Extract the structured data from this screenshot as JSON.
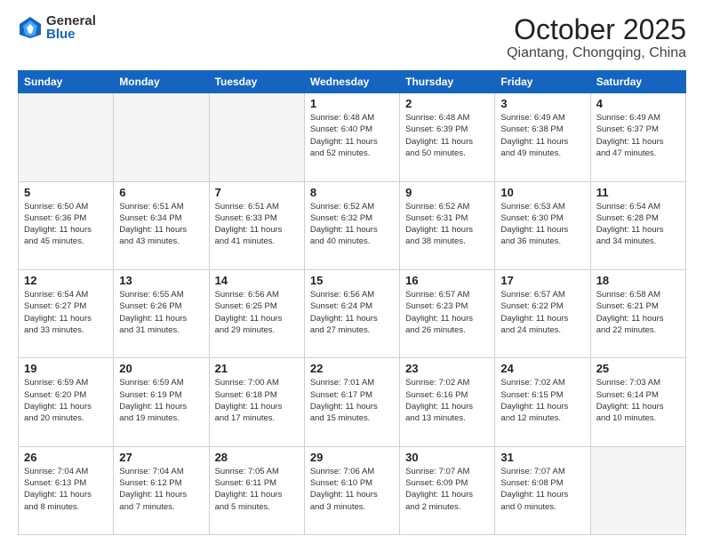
{
  "logo": {
    "general": "General",
    "blue": "Blue"
  },
  "header": {
    "month": "October 2025",
    "location": "Qiantang, Chongqing, China"
  },
  "weekdays": [
    "Sunday",
    "Monday",
    "Tuesday",
    "Wednesday",
    "Thursday",
    "Friday",
    "Saturday"
  ],
  "weeks": [
    [
      {
        "day": "",
        "info": ""
      },
      {
        "day": "",
        "info": ""
      },
      {
        "day": "",
        "info": ""
      },
      {
        "day": "1",
        "info": "Sunrise: 6:48 AM\nSunset: 6:40 PM\nDaylight: 11 hours\nand 52 minutes."
      },
      {
        "day": "2",
        "info": "Sunrise: 6:48 AM\nSunset: 6:39 PM\nDaylight: 11 hours\nand 50 minutes."
      },
      {
        "day": "3",
        "info": "Sunrise: 6:49 AM\nSunset: 6:38 PM\nDaylight: 11 hours\nand 49 minutes."
      },
      {
        "day": "4",
        "info": "Sunrise: 6:49 AM\nSunset: 6:37 PM\nDaylight: 11 hours\nand 47 minutes."
      }
    ],
    [
      {
        "day": "5",
        "info": "Sunrise: 6:50 AM\nSunset: 6:36 PM\nDaylight: 11 hours\nand 45 minutes."
      },
      {
        "day": "6",
        "info": "Sunrise: 6:51 AM\nSunset: 6:34 PM\nDaylight: 11 hours\nand 43 minutes."
      },
      {
        "day": "7",
        "info": "Sunrise: 6:51 AM\nSunset: 6:33 PM\nDaylight: 11 hours\nand 41 minutes."
      },
      {
        "day": "8",
        "info": "Sunrise: 6:52 AM\nSunset: 6:32 PM\nDaylight: 11 hours\nand 40 minutes."
      },
      {
        "day": "9",
        "info": "Sunrise: 6:52 AM\nSunset: 6:31 PM\nDaylight: 11 hours\nand 38 minutes."
      },
      {
        "day": "10",
        "info": "Sunrise: 6:53 AM\nSunset: 6:30 PM\nDaylight: 11 hours\nand 36 minutes."
      },
      {
        "day": "11",
        "info": "Sunrise: 6:54 AM\nSunset: 6:28 PM\nDaylight: 11 hours\nand 34 minutes."
      }
    ],
    [
      {
        "day": "12",
        "info": "Sunrise: 6:54 AM\nSunset: 6:27 PM\nDaylight: 11 hours\nand 33 minutes."
      },
      {
        "day": "13",
        "info": "Sunrise: 6:55 AM\nSunset: 6:26 PM\nDaylight: 11 hours\nand 31 minutes."
      },
      {
        "day": "14",
        "info": "Sunrise: 6:56 AM\nSunset: 6:25 PM\nDaylight: 11 hours\nand 29 minutes."
      },
      {
        "day": "15",
        "info": "Sunrise: 6:56 AM\nSunset: 6:24 PM\nDaylight: 11 hours\nand 27 minutes."
      },
      {
        "day": "16",
        "info": "Sunrise: 6:57 AM\nSunset: 6:23 PM\nDaylight: 11 hours\nand 26 minutes."
      },
      {
        "day": "17",
        "info": "Sunrise: 6:57 AM\nSunset: 6:22 PM\nDaylight: 11 hours\nand 24 minutes."
      },
      {
        "day": "18",
        "info": "Sunrise: 6:58 AM\nSunset: 6:21 PM\nDaylight: 11 hours\nand 22 minutes."
      }
    ],
    [
      {
        "day": "19",
        "info": "Sunrise: 6:59 AM\nSunset: 6:20 PM\nDaylight: 11 hours\nand 20 minutes."
      },
      {
        "day": "20",
        "info": "Sunrise: 6:59 AM\nSunset: 6:19 PM\nDaylight: 11 hours\nand 19 minutes."
      },
      {
        "day": "21",
        "info": "Sunrise: 7:00 AM\nSunset: 6:18 PM\nDaylight: 11 hours\nand 17 minutes."
      },
      {
        "day": "22",
        "info": "Sunrise: 7:01 AM\nSunset: 6:17 PM\nDaylight: 11 hours\nand 15 minutes."
      },
      {
        "day": "23",
        "info": "Sunrise: 7:02 AM\nSunset: 6:16 PM\nDaylight: 11 hours\nand 13 minutes."
      },
      {
        "day": "24",
        "info": "Sunrise: 7:02 AM\nSunset: 6:15 PM\nDaylight: 11 hours\nand 12 minutes."
      },
      {
        "day": "25",
        "info": "Sunrise: 7:03 AM\nSunset: 6:14 PM\nDaylight: 11 hours\nand 10 minutes."
      }
    ],
    [
      {
        "day": "26",
        "info": "Sunrise: 7:04 AM\nSunset: 6:13 PM\nDaylight: 11 hours\nand 8 minutes."
      },
      {
        "day": "27",
        "info": "Sunrise: 7:04 AM\nSunset: 6:12 PM\nDaylight: 11 hours\nand 7 minutes."
      },
      {
        "day": "28",
        "info": "Sunrise: 7:05 AM\nSunset: 6:11 PM\nDaylight: 11 hours\nand 5 minutes."
      },
      {
        "day": "29",
        "info": "Sunrise: 7:06 AM\nSunset: 6:10 PM\nDaylight: 11 hours\nand 3 minutes."
      },
      {
        "day": "30",
        "info": "Sunrise: 7:07 AM\nSunset: 6:09 PM\nDaylight: 11 hours\nand 2 minutes."
      },
      {
        "day": "31",
        "info": "Sunrise: 7:07 AM\nSunset: 6:08 PM\nDaylight: 11 hours\nand 0 minutes."
      },
      {
        "day": "",
        "info": ""
      }
    ]
  ]
}
